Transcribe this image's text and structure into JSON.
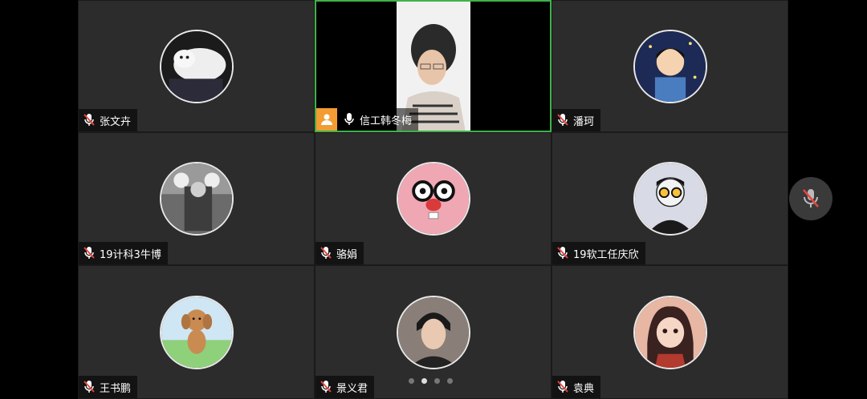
{
  "participants": [
    {
      "name": "张文卉",
      "avatar": "cat-avatar",
      "muted": true
    },
    {
      "name": "信工韩冬梅",
      "avatar": "video-feed",
      "muted": false,
      "host": true
    },
    {
      "name": "潘珂",
      "avatar": "cartoon-boy-avatar",
      "muted": true
    },
    {
      "name": "19计科3牛博",
      "avatar": "photo-avatar",
      "muted": true
    },
    {
      "name": "骆娟",
      "avatar": "pink-plush-avatar",
      "muted": true
    },
    {
      "name": "19软工任庆欣",
      "avatar": "glasses-man-avatar",
      "muted": true
    },
    {
      "name": "王书鹏",
      "avatar": "dog-cartoon-avatar",
      "muted": true
    },
    {
      "name": "景义君",
      "avatar": "person-photo-avatar",
      "muted": true
    },
    {
      "name": "袁典",
      "avatar": "anime-girl-avatar",
      "muted": true
    }
  ],
  "pagination": {
    "pages": 4,
    "current": 2
  },
  "colors": {
    "active_border": "#3fb24a",
    "host_badge": "#f39c33",
    "muted_mic": "#e9463f"
  }
}
